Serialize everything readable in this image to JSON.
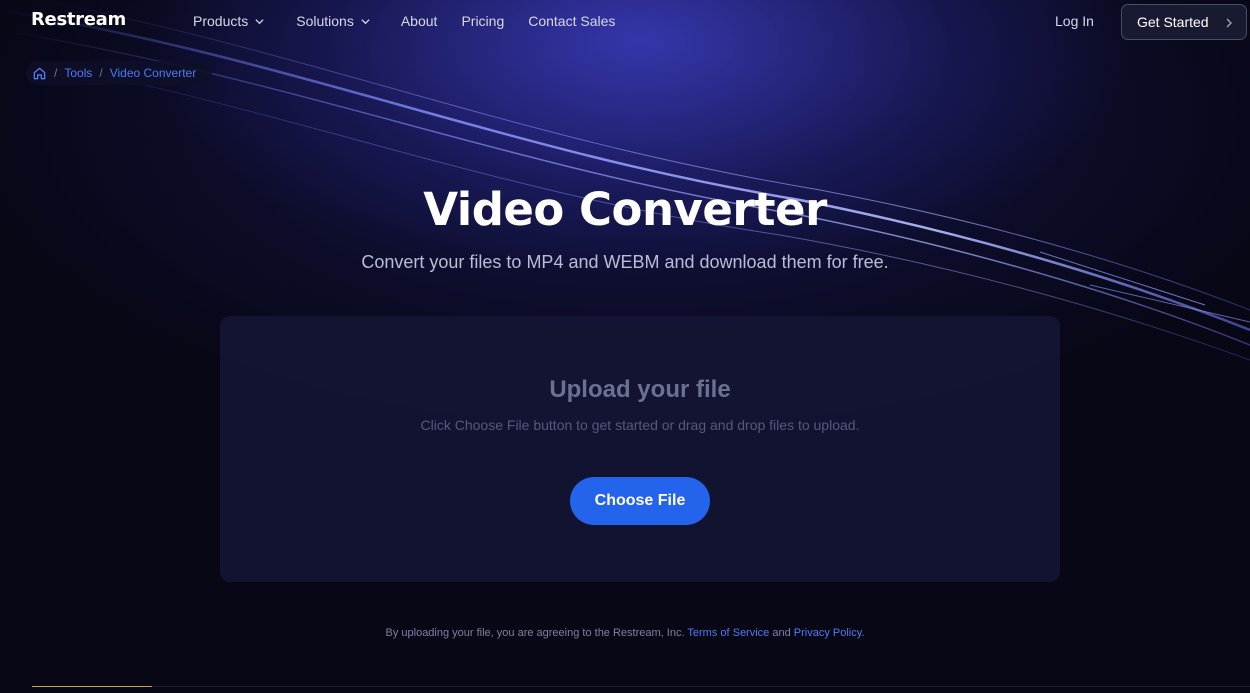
{
  "brand": {
    "logo_text": "Restream"
  },
  "nav": {
    "items": [
      {
        "label": "Products",
        "has_dropdown": true
      },
      {
        "label": "Solutions",
        "has_dropdown": true
      },
      {
        "label": "About",
        "has_dropdown": false
      },
      {
        "label": "Pricing",
        "has_dropdown": false
      },
      {
        "label": "Contact Sales",
        "has_dropdown": false
      }
    ],
    "login_label": "Log In",
    "cta_label": "Get Started"
  },
  "breadcrumb": {
    "home_icon": "home-icon",
    "items": [
      "Tools",
      "Video Converter"
    ],
    "separator": "/"
  },
  "hero": {
    "title": "Video Converter",
    "subtitle": "Convert your files to MP4 and WEBM and download them for free."
  },
  "upload": {
    "title": "Upload your file",
    "description": "Click Choose File button to get started or drag and drop files to upload.",
    "button_label": "Choose File"
  },
  "footnote": {
    "prefix": "By uploading your file, you are agreeing to the Restream, Inc.",
    "terms_label": "Terms of Service",
    "conjunction": "and",
    "privacy_label": "Privacy Policy",
    "suffix": "."
  },
  "colors": {
    "background": "#070716",
    "accent_blue": "#2463eb",
    "link_blue": "#4f7cf5",
    "card": "#14163a"
  }
}
